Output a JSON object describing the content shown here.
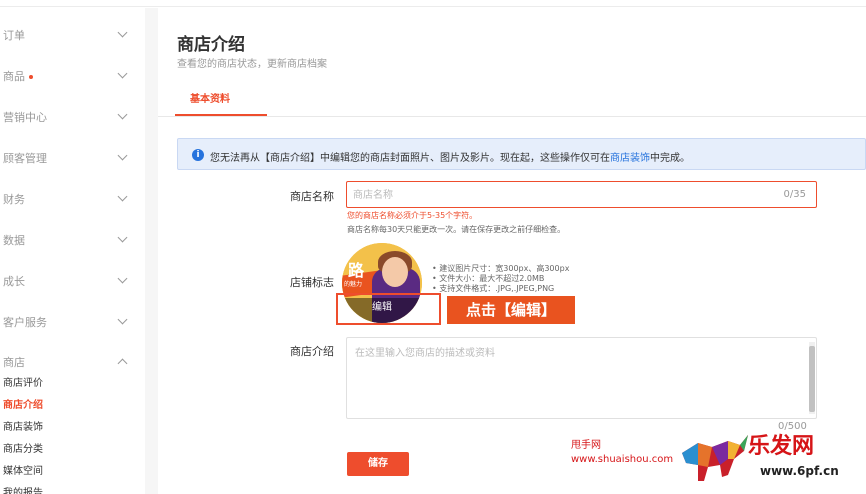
{
  "sidebar": {
    "items": [
      {
        "label": "订单"
      },
      {
        "label": "商品",
        "dot": true
      },
      {
        "label": "营销中心"
      },
      {
        "label": "顾客管理"
      },
      {
        "label": "财务"
      },
      {
        "label": "数据"
      },
      {
        "label": "成长"
      },
      {
        "label": "客户服务"
      },
      {
        "label": "商店"
      }
    ],
    "shop_sub": [
      {
        "label": "商店评价"
      },
      {
        "label": "商店介绍",
        "active": true
      },
      {
        "label": "商店装饰"
      },
      {
        "label": "商店分类"
      },
      {
        "label": "媒体空间"
      },
      {
        "label": "我的报告"
      }
    ]
  },
  "page": {
    "title": "商店介绍",
    "subtitle": "查看您的商店状态，更新商店档案",
    "tab_basic": "基本资料"
  },
  "notice": {
    "icon": "info-icon",
    "text_before": "您无法再从【商店介绍】中编辑您的商店封面照片、图片及影片。现在起，这些操作仅可在",
    "link": "商店装饰",
    "text_after": "中完成。"
  },
  "form": {
    "name_label": "商店名称",
    "name_placeholder": "商店名称",
    "name_counter": "0/35",
    "name_error": "您的商店名称必须介于5-35个字符。",
    "name_hint": "商店名称每30天只能更改一次。请在保存更改之前仔细检查。",
    "logo_label": "店铺标志",
    "logo_text_big": "路",
    "logo_text_small": "的魅力",
    "logo_edit": "编辑",
    "logo_hints": [
      "• 建议图片尺寸：宽300px、高300px",
      "• 文件大小：最大不超过2.0MB",
      "• 支持文件格式：.JPG,.JPEG,PNG"
    ],
    "desc_label": "商店介绍",
    "desc_placeholder": "在这里输入您商店的描述或资料",
    "desc_counter": "0/500",
    "save": "储存"
  },
  "callout": "点击【编辑】",
  "watermark": {
    "cn": "甩手网",
    "url": "www.shuaishou.com",
    "brand": "乐发网",
    "brand_url": "www.6pf.cn"
  },
  "colors": {
    "accent": "#ee4d2d",
    "link": "#2673dd",
    "notice_bg": "#e6eefb"
  }
}
